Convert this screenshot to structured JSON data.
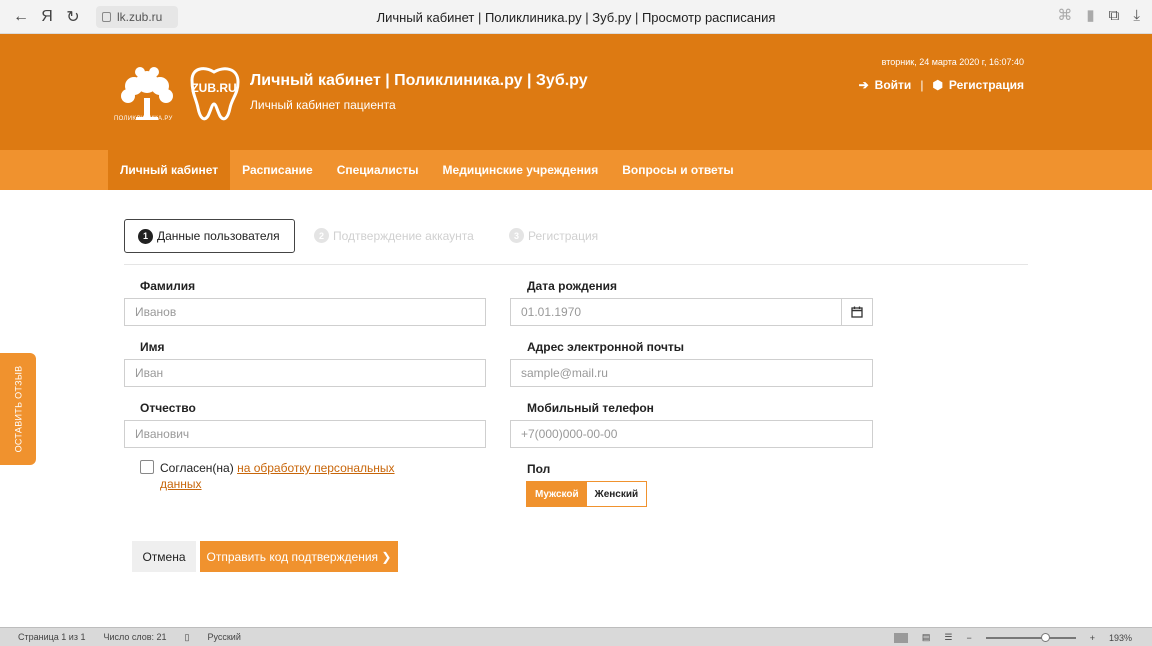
{
  "browser": {
    "url": "lk.zub.ru",
    "tab_title": "Личный кабинет | Поликлиника.ру | Зуб.ру | Просмотр расписания",
    "back": "←",
    "ya": "Я",
    "reload": "↻"
  },
  "header": {
    "tree_logo_caption": "ПОЛИКЛИНИКА.РУ",
    "zub_logo_text": "ZUB.RU",
    "title": "Личный кабинет | Поликлиника.ру | Зуб.ру",
    "subtitle": "Личный кабинет пациента",
    "datetime": "вторник, 24 марта 2020 г, 16:07:40",
    "login": "Войти",
    "register": "Регистрация",
    "separator": "|"
  },
  "nav": {
    "items": [
      "Личный кабинет",
      "Расписание",
      "Специалисты",
      "Медицинские учреждения",
      "Вопросы и ответы"
    ]
  },
  "steps": [
    {
      "num": "1",
      "label": "Данные пользователя"
    },
    {
      "num": "2",
      "label": "Подтверждение аккаунта"
    },
    {
      "num": "3",
      "label": "Регистрация"
    }
  ],
  "form": {
    "surname_label": "Фамилия",
    "surname_placeholder": "Иванов",
    "name_label": "Имя",
    "name_placeholder": "Иван",
    "patronymic_label": "Отчество",
    "patronymic_placeholder": "Иванович",
    "birth_label": "Дата рождения",
    "birth_placeholder": "01.01.1970",
    "email_label": "Адрес электронной почты",
    "email_placeholder": "sample@mail.ru",
    "phone_label": "Мобильный телефон",
    "phone_placeholder": "+7(000)000-00-00",
    "consent_text": "Согласен(на) ",
    "consent_link": "на обработку персональных данных",
    "gender_label": "Пол",
    "gender_male": "Мужской",
    "gender_female": "Женский",
    "cancel": "Отмена",
    "send": "Отправить код подтверждения ❯"
  },
  "feedback_tab": "ОСТАВИТЬ ОТЗЫВ",
  "status_bar": {
    "page": "Страница 1 из 1",
    "words": "Число слов: 21",
    "lang": "Русский",
    "zoom": "193%"
  }
}
